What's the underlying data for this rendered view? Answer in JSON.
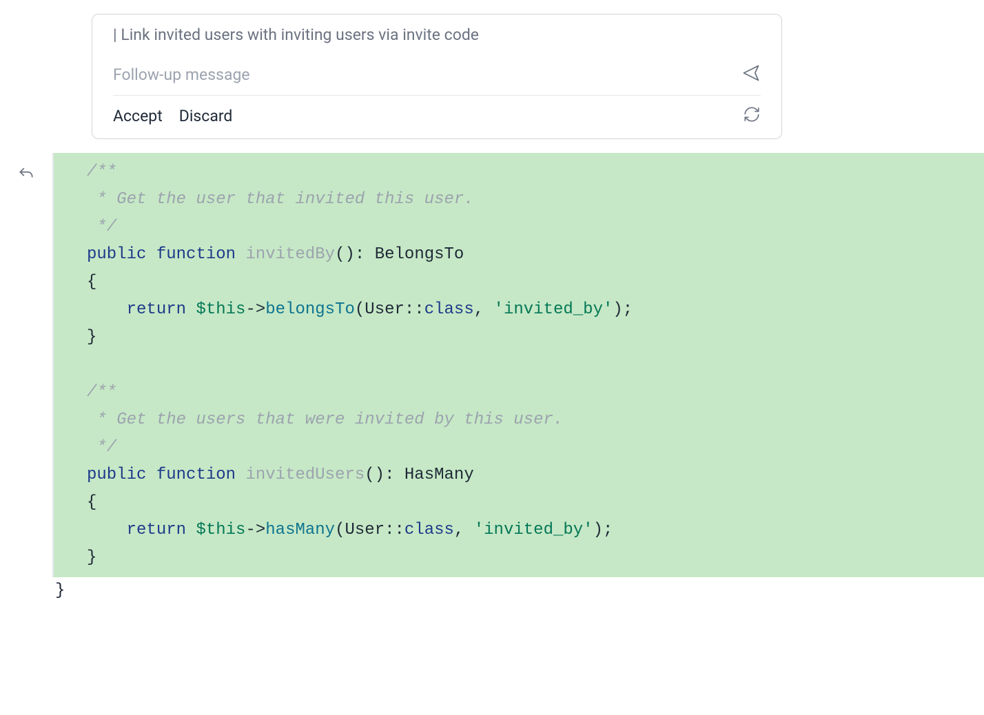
{
  "panel": {
    "prompt": "| Link invited users with inviting users via invite code",
    "followup_placeholder": "Follow-up message",
    "accept_label": "Accept",
    "discard_label": "Discard"
  },
  "code": {
    "comment1_line1": "/**",
    "comment1_line2": " * Get the user that invited this user.",
    "comment1_line3": " */",
    "fn1_public": "public",
    "fn1_function": "function",
    "fn1_name": "invitedBy",
    "fn1_parens": "()",
    "fn1_colon": ":",
    "fn1_return_type": "BelongsTo",
    "brace_open": "{",
    "fn1_return": "return",
    "fn1_this": "$this",
    "fn1_arrow": "->",
    "fn1_method": "belongsTo",
    "fn1_arg_open": "(",
    "fn1_arg_user": "User",
    "fn1_dbl_colon": "::",
    "fn1_class": "class",
    "fn1_comma": ", ",
    "fn1_string": "'invited_by'",
    "fn1_arg_close": ");",
    "brace_close": "}",
    "comment2_line1": "/**",
    "comment2_line2": " * Get the users that were invited by this user.",
    "comment2_line3": " */",
    "fn2_name": "invitedUsers",
    "fn2_return_type": "HasMany",
    "fn2_method": "hasMany",
    "final_brace": "}"
  }
}
